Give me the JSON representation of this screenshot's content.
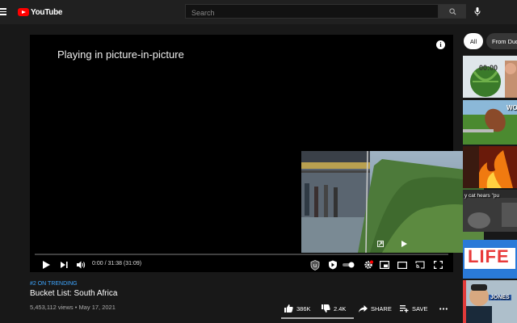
{
  "header": {
    "logo_text": "YouTube",
    "search_placeholder": "Search"
  },
  "player": {
    "status_text": "Playing in picture-in-picture",
    "time_text": "0:00 / 31:38 (31:09)",
    "progress_fraction": 0.0
  },
  "video": {
    "trending_tag": "#2 ON TRENDING",
    "title": "Bucket List: South Africa",
    "meta": "5,453,112 views • May 17, 2021",
    "likes": "386K",
    "dislikes": "2.4K",
    "share_label": "SHARE",
    "save_label": "SAVE"
  },
  "sidebar": {
    "chips": [
      "All",
      "From Dude Perfect"
    ],
    "thumbnails": [
      {
        "overlay": "00:00"
      },
      {
        "overlay": "WO LO"
      },
      {
        "overlay": ""
      },
      {
        "overlay": "y cat hears \"pu"
      },
      {
        "overlay": ""
      },
      {
        "overlay": "LIFE"
      },
      {
        "overlay": "JONES"
      }
    ]
  },
  "colors": {
    "accent_red": "#ff0000",
    "link_blue": "#3ea6ff",
    "background": "#181818"
  }
}
